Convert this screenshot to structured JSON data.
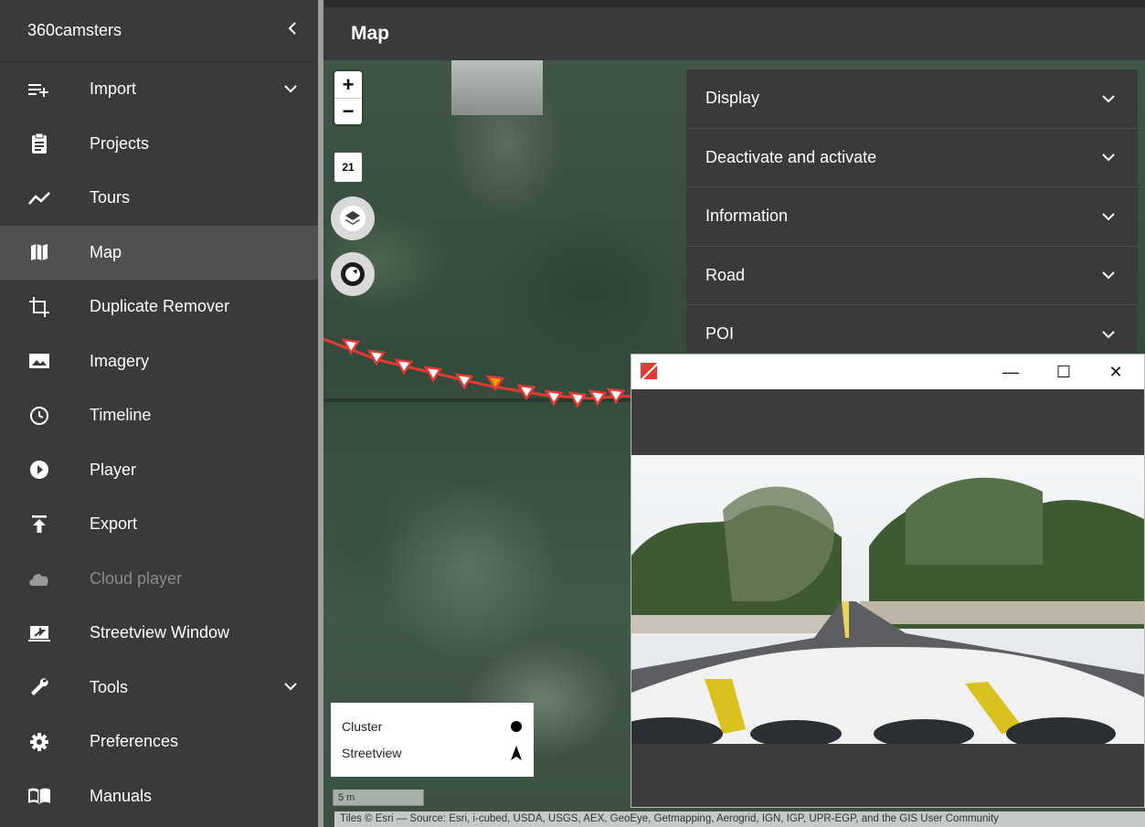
{
  "sidebar": {
    "title": "360camsters",
    "collapse_icon": "chevron-left-icon",
    "items": [
      {
        "label": "Import",
        "icon": "import-list-icon",
        "expandable": true
      },
      {
        "label": "Projects",
        "icon": "clipboard-icon"
      },
      {
        "label": "Tours",
        "icon": "trend-line-icon"
      },
      {
        "label": "Map",
        "icon": "map-icon",
        "active": true
      },
      {
        "label": "Duplicate Remover",
        "icon": "crop-icon"
      },
      {
        "label": "Imagery",
        "icon": "image-icon"
      },
      {
        "label": "Timeline",
        "icon": "clock-icon"
      },
      {
        "label": "Player",
        "icon": "play-icon"
      },
      {
        "label": "Export",
        "icon": "upload-icon"
      },
      {
        "label": "Cloud player",
        "icon": "cloud-icon",
        "disabled": true
      },
      {
        "label": "Streetview Window",
        "icon": "window-arrow-icon"
      },
      {
        "label": "Tools",
        "icon": "wrench-icon",
        "expandable": true
      },
      {
        "label": "Preferences",
        "icon": "gear-icon"
      },
      {
        "label": "Manuals",
        "icon": "book-icon"
      }
    ]
  },
  "header": {
    "title": "Map"
  },
  "map": {
    "zoom_in": "+",
    "zoom_out": "−",
    "zoom_level": "21",
    "legend": {
      "cluster": "Cluster",
      "streetview": "Streetview"
    },
    "scale": "5 m",
    "attribution": "Tiles © Esri — Source: Esri, i-cubed, USDA, USGS, AEX, GeoEye, Getmapping, Aerogrid, IGN, IGP, UPR-EGP, and the GIS User Community"
  },
  "panel": {
    "sections": [
      "Display",
      "Deactivate and activate",
      "Information",
      "Road",
      "POI"
    ]
  },
  "streetview_window": {
    "minimize": "—",
    "maximize": "☐",
    "close": "✕"
  },
  "colors": {
    "sidebar_bg": "#3a3a3a",
    "active_bg": "#505050",
    "track": "#e53935",
    "track_current": "#f4a300"
  }
}
